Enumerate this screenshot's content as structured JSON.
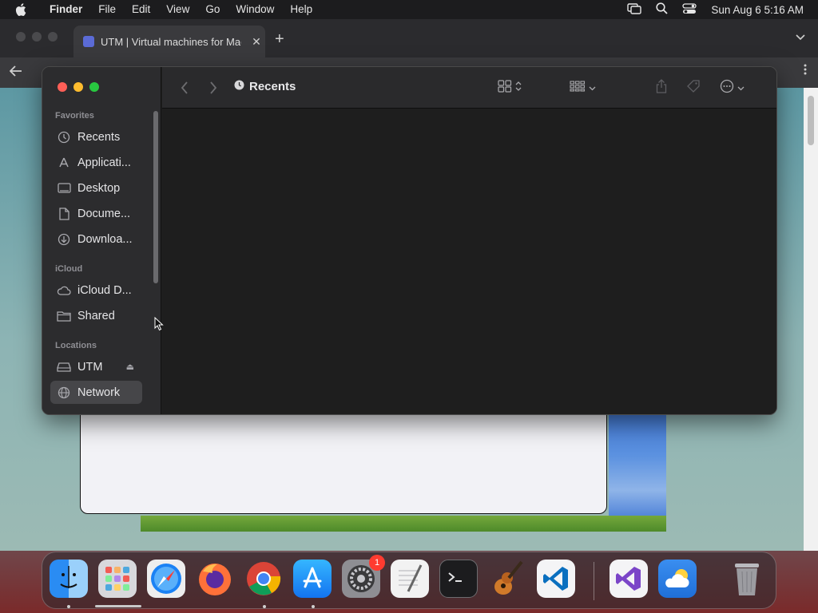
{
  "menubar": {
    "app_name": "Finder",
    "menus": [
      "File",
      "Edit",
      "View",
      "Go",
      "Window",
      "Help"
    ],
    "clock": "Sun Aug 6  5:16 AM",
    "icons": [
      "apple-icon",
      "screen-mirroring-icon",
      "spotlight-search-icon",
      "control-center-icon"
    ]
  },
  "browser": {
    "tab_title": "UTM | Virtual machines for Mac",
    "tab_close": "✕",
    "new_tab": "+"
  },
  "finder": {
    "title": "Recents",
    "sidebar": {
      "favorites_header": "Favorites",
      "favorites": [
        {
          "label": "Recents",
          "icon": "clock-icon"
        },
        {
          "label": "Applicati...",
          "icon": "applications-icon"
        },
        {
          "label": "Desktop",
          "icon": "desktop-icon"
        },
        {
          "label": "Docume...",
          "icon": "document-icon"
        },
        {
          "label": "Downloa...",
          "icon": "download-icon"
        }
      ],
      "icloud_header": "iCloud",
      "icloud": [
        {
          "label": "iCloud D...",
          "icon": "cloud-icon"
        },
        {
          "label": "Shared",
          "icon": "shared-folder-icon"
        }
      ],
      "locations_header": "Locations",
      "locations": [
        {
          "label": "UTM",
          "icon": "drive-icon",
          "eject": "⏏"
        },
        {
          "label": "Network",
          "icon": "network-icon",
          "selected": true
        }
      ]
    }
  },
  "dock": {
    "apps": [
      {
        "name": "Finder",
        "running": true
      },
      {
        "name": "Launchpad",
        "running": false
      },
      {
        "name": "Safari",
        "running": false
      },
      {
        "name": "Firefox",
        "running": false
      },
      {
        "name": "Google Chrome",
        "running": true
      },
      {
        "name": "App Store",
        "running": true
      },
      {
        "name": "System Settings",
        "running": false,
        "badge": "1"
      },
      {
        "name": "TextEdit",
        "running": false
      },
      {
        "name": "Terminal",
        "running": false
      },
      {
        "name": "GarageBand",
        "running": false
      },
      {
        "name": "Visual Studio Code",
        "running": false
      },
      {
        "name": "Visual Studio",
        "running": false
      },
      {
        "name": "Weather",
        "running": false
      },
      {
        "name": "Trash",
        "running": false
      }
    ]
  },
  "colors": {
    "finder_bg": "#1e1e1e",
    "sidebar_bg": "#2c2c2e",
    "close": "#ff5f57",
    "minimize": "#febc2e",
    "zoom": "#28c840",
    "badge": "#ff3b30"
  }
}
